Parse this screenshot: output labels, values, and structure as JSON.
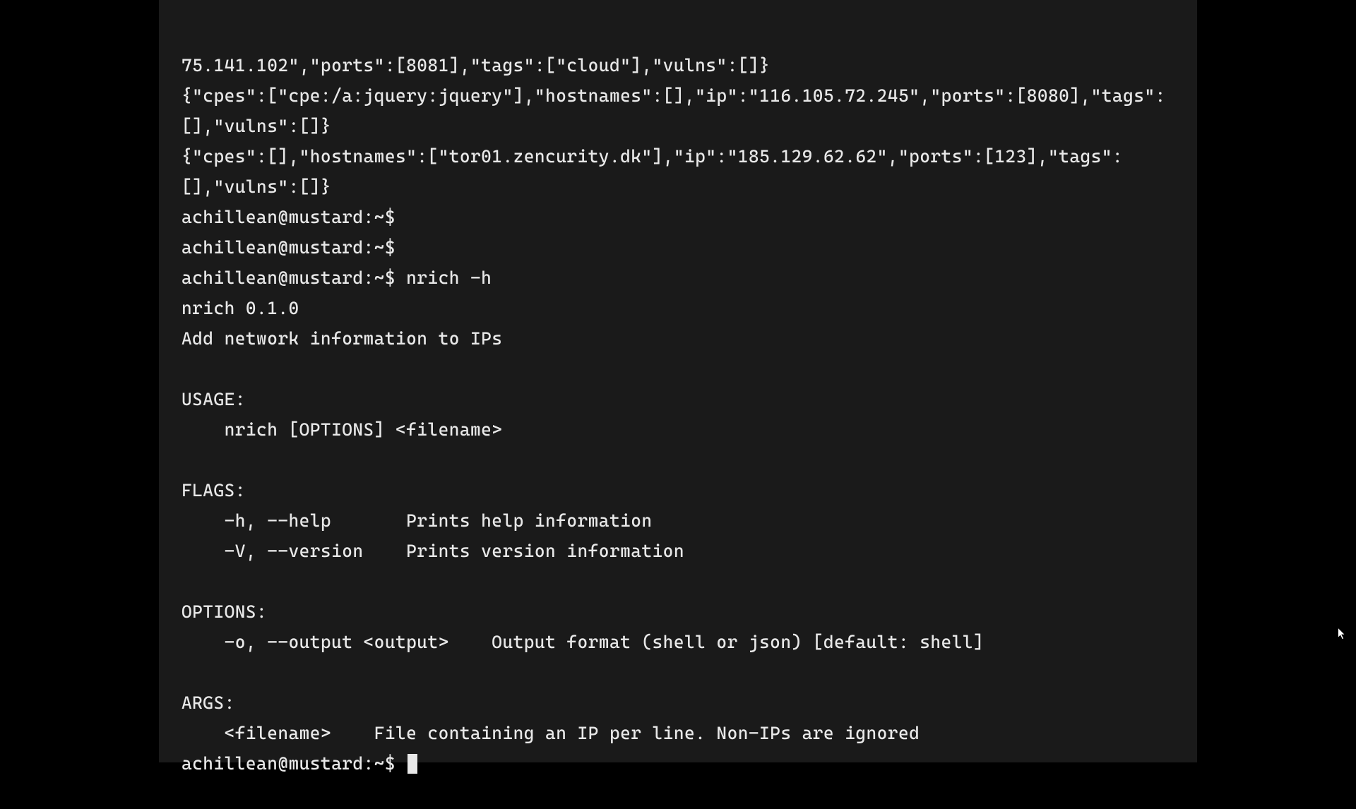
{
  "output": {
    "json_line1": "75.141.102\",\"ports\":[8081],\"tags\":[\"cloud\"],\"vulns\":[]}",
    "json_line2": "{\"cpes\":[\"cpe:/a:jquery:jquery\"],\"hostnames\":[],\"ip\":\"116.105.72.245\",\"ports\":[8080],\"tags\":[],\"vulns\":[]}",
    "json_line3": "{\"cpes\":[],\"hostnames\":[\"tor01.zencurity.dk\"],\"ip\":\"185.129.62.62\",\"ports\":[123],\"tags\":[],\"vulns\":[]}"
  },
  "prompt": "achillean@mustard:~$",
  "command": "nrich -h",
  "help": {
    "version": "nrich 0.1.0",
    "desc": "Add network information to IPs",
    "usage_header": "USAGE:",
    "usage_line": "    nrich [OPTIONS] <filename>",
    "flags_header": "FLAGS:",
    "flag_help": "    -h, --help       Prints help information",
    "flag_version": "    -V, --version    Prints version information",
    "options_header": "OPTIONS:",
    "option_output": "    -o, --output <output>    Output format (shell or json) [default: shell]",
    "args_header": "ARGS:",
    "arg_filename": "    <filename>    File containing an IP per line. Non-IPs are ignored"
  }
}
